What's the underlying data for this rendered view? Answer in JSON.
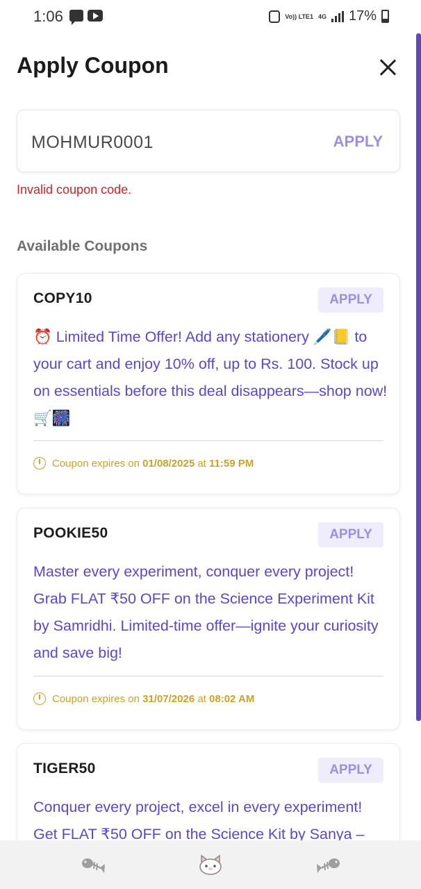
{
  "status_bar": {
    "time": "1:06",
    "volte_label": "Vo)) LTE1",
    "network_label": "4G",
    "battery": "17%",
    "icons": [
      "message-icon",
      "youtube-icon",
      "alarm-icon",
      "signal-icon",
      "battery-icon"
    ]
  },
  "header": {
    "title": "Apply Coupon",
    "close_icon": "close-icon"
  },
  "coupon_input": {
    "value": "MOHMUR0001",
    "apply_label": "APPLY",
    "error": "Invalid coupon code."
  },
  "available": {
    "title": "Available Coupons",
    "coupons": [
      {
        "code": "COPY10",
        "apply_label": "APPLY",
        "description": "⏰ Limited Time Offer! Add any stationery 🖊️📒 to your cart and enjoy 10% off, up to Rs. 100. Stock up on essentials before this deal disappears—shop now! 🛒🎆",
        "expiry_prefix": "Coupon expires on",
        "expiry_date": "01/08/2025",
        "expiry_at": "at",
        "expiry_time": "11:59 PM"
      },
      {
        "code": "POOKIE50",
        "apply_label": "APPLY",
        "description": "Master every experiment, conquer every project! Grab FLAT ₹50 OFF on the Science Experiment Kit by Samridhi. Limited-time offer—ignite your curiosity and save big!",
        "expiry_prefix": "Coupon expires on",
        "expiry_date": "31/07/2026",
        "expiry_at": "at",
        "expiry_time": "08:02 AM"
      },
      {
        "code": "TIGER50",
        "apply_label": "APPLY",
        "description": "Conquer every project, excel in every experiment! Get FLAT ₹50 OFF on the Science Kit by Sanya –"
      }
    ]
  },
  "bottom_bar": {
    "icons": [
      "fish-bone-icon",
      "cat-face-icon",
      "fish-bone-icon"
    ]
  },
  "colors": {
    "accent": "#5b47c8",
    "apply_text": "#9c8fe0",
    "error": "#c62828",
    "expiry": "#c9a227"
  }
}
